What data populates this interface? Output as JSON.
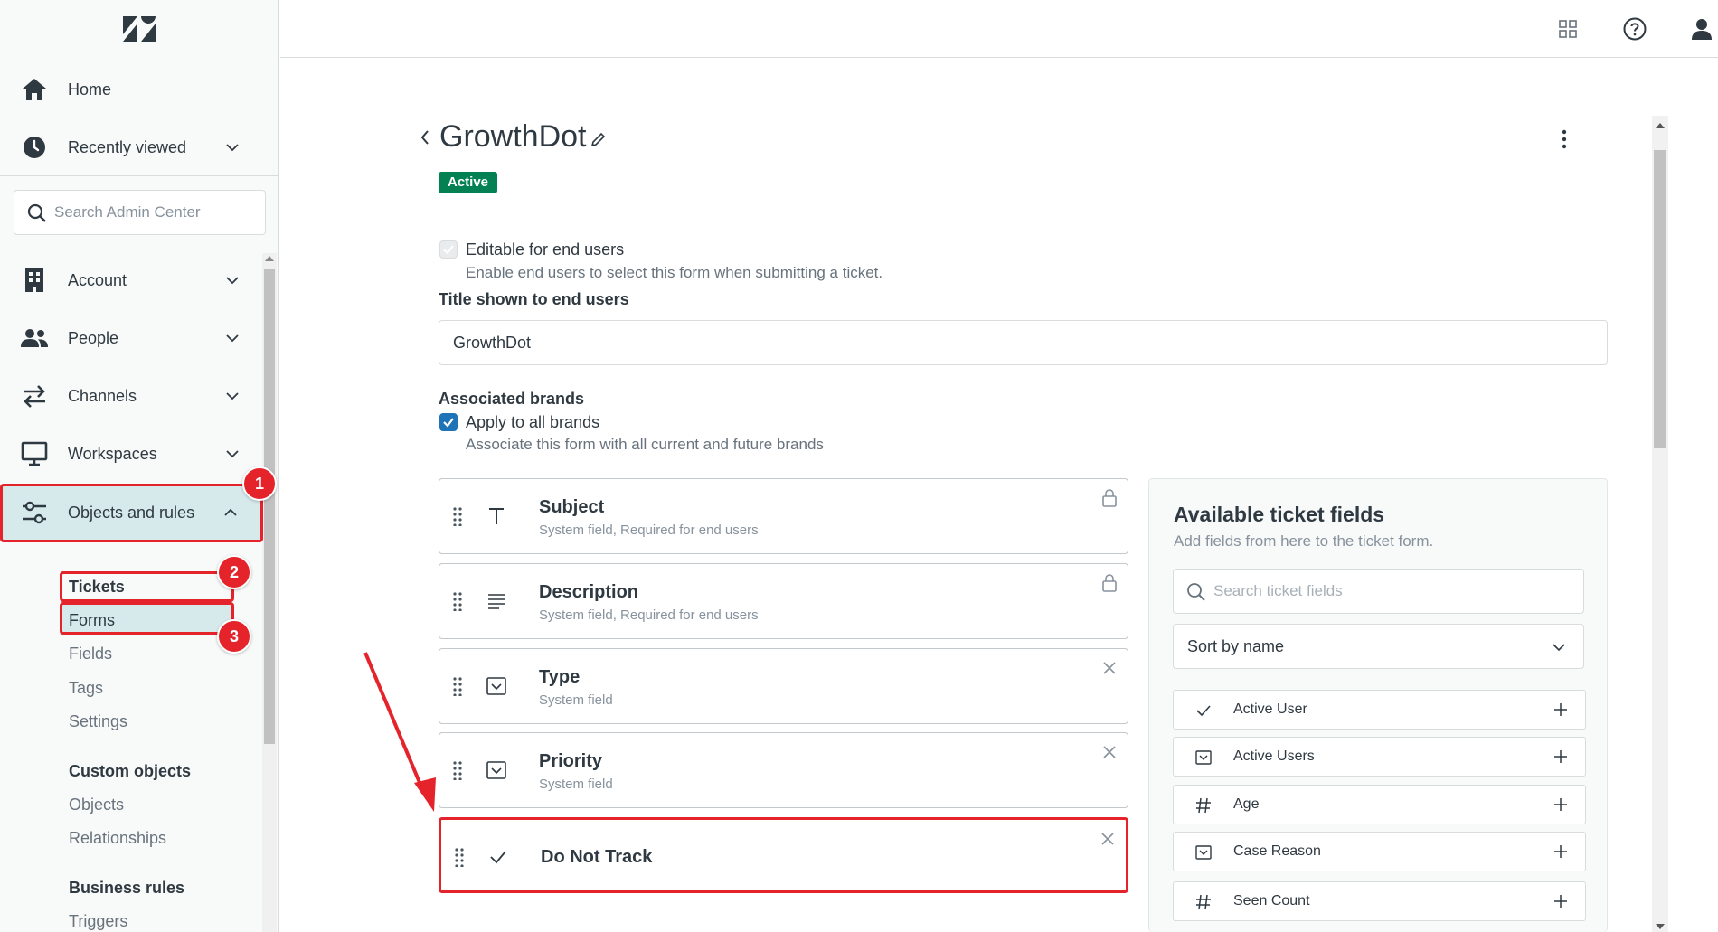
{
  "sidebar": {
    "home_label": "Home",
    "recent_label": "Recently viewed",
    "search_placeholder": "Search Admin Center",
    "items": [
      {
        "label": "Account"
      },
      {
        "label": "People"
      },
      {
        "label": "Channels"
      },
      {
        "label": "Workspaces"
      },
      {
        "label": "Objects and rules"
      }
    ],
    "tickets_section": {
      "heading": "Tickets",
      "links": [
        "Forms",
        "Fields",
        "Tags",
        "Settings"
      ]
    },
    "custom_objects_section": {
      "heading": "Custom objects",
      "links": [
        "Objects",
        "Relationships"
      ]
    },
    "business_rules_section": {
      "heading": "Business rules",
      "links": [
        "Triggers"
      ]
    }
  },
  "annotations": {
    "badge1": "1",
    "badge2": "2",
    "badge3": "3"
  },
  "form": {
    "title": "GrowthDot",
    "status": "Active",
    "editable_label": "Editable for end users",
    "editable_hint": "Enable end users to select this form when submitting a ticket.",
    "title_shown_label": "Title shown to end users",
    "title_shown_value": "GrowthDot",
    "brands_label": "Associated brands",
    "apply_all_label": "Apply to all brands",
    "apply_all_hint": "Associate this form with all current and future brands",
    "fields": [
      {
        "name": "Subject",
        "desc": "System field, Required for end users",
        "icon": "text-icon",
        "action": "lock-icon"
      },
      {
        "name": "Description",
        "desc": "System field, Required for end users",
        "icon": "paragraph-icon",
        "action": "lock-icon"
      },
      {
        "name": "Type",
        "desc": "System field",
        "icon": "dropdown-icon",
        "action": "close-icon"
      },
      {
        "name": "Priority",
        "desc": "System field",
        "icon": "dropdown-icon",
        "action": "close-icon"
      },
      {
        "name": "Do Not Track",
        "desc": "",
        "icon": "checkbox-icon",
        "action": "close-icon"
      }
    ]
  },
  "available": {
    "title": "Available ticket fields",
    "hint": "Add fields from here to the ticket form.",
    "search_placeholder": "Search ticket fields",
    "sort_label": "Sort by name",
    "items": [
      {
        "name": "Active User",
        "icon": "checkbox-icon"
      },
      {
        "name": "Active Users",
        "icon": "dropdown-icon"
      },
      {
        "name": "Age",
        "icon": "number-icon"
      },
      {
        "name": "Case Reason",
        "icon": "dropdown-icon"
      },
      {
        "name": "Seen Count",
        "icon": "number-icon"
      }
    ]
  },
  "colors": {
    "accent_red": "#e5232b",
    "status_green": "#038153",
    "checkbox_blue": "#1f73b7",
    "active_nav": "#d6eaec"
  }
}
